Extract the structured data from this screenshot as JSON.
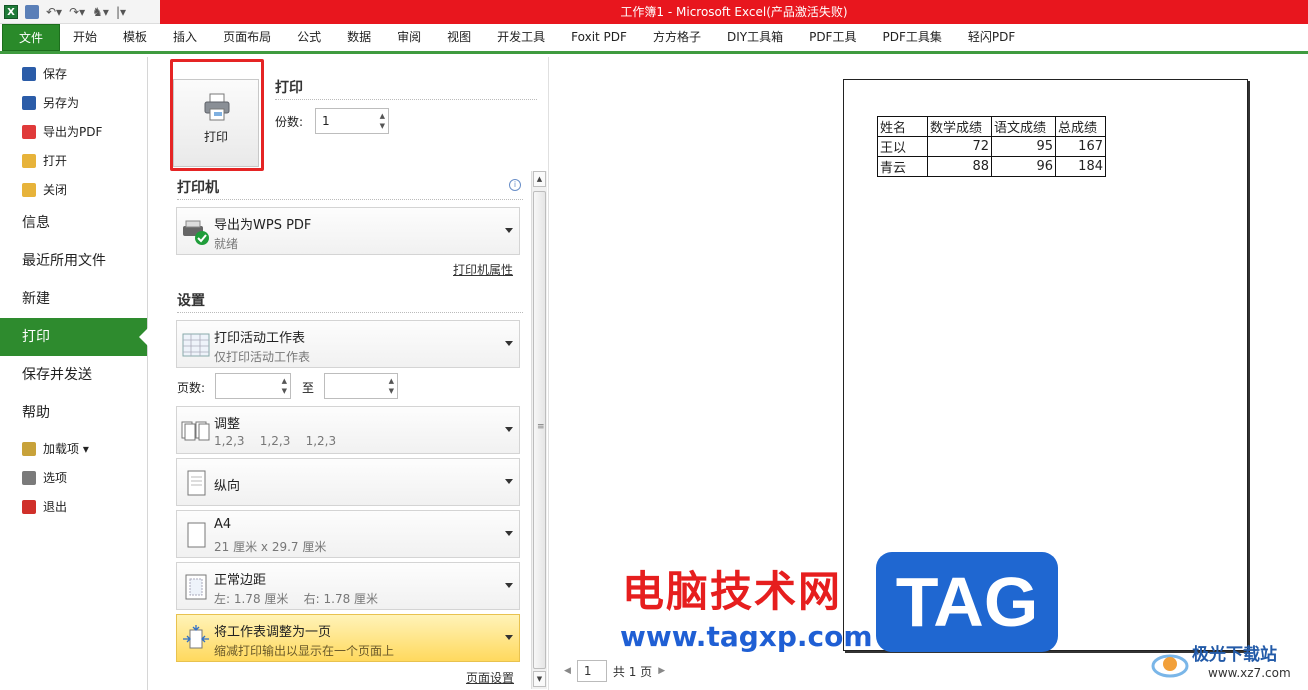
{
  "window": {
    "title": "工作簿1 - Microsoft Excel(产品激活失败)"
  },
  "ribbon": {
    "tabs": [
      "文件",
      "开始",
      "模板",
      "插入",
      "页面布局",
      "公式",
      "数据",
      "审阅",
      "视图",
      "开发工具",
      "Foxit PDF",
      "方方格子",
      "DIY工具箱",
      "PDF工具",
      "PDF工具集",
      "轻闪PDF"
    ]
  },
  "leftnav": {
    "top_items": [
      {
        "label": "保存",
        "icon": "save-icon",
        "color": "#2b5ca8"
      },
      {
        "label": "另存为",
        "icon": "save-as-icon",
        "color": "#2b5ca8"
      },
      {
        "label": "导出为PDF",
        "icon": "pdf-icon",
        "color": "#e03a3a"
      },
      {
        "label": "打开",
        "icon": "folder-open-icon",
        "color": "#e7b33a"
      },
      {
        "label": "关闭",
        "icon": "folder-close-icon",
        "color": "#e7b33a"
      }
    ],
    "big_items": [
      "信息",
      "最近所用文件",
      "新建",
      "打印",
      "保存并发送",
      "帮助"
    ],
    "active": "打印",
    "bottom_items": [
      {
        "label": "加载项 ▾",
        "icon": "addin-icon",
        "color": "#c8a23a"
      },
      {
        "label": "选项",
        "icon": "options-icon",
        "color": "#7a7a7a"
      },
      {
        "label": "退出",
        "icon": "exit-icon",
        "color": "#d0302a"
      }
    ]
  },
  "print": {
    "button_label": "打印",
    "section_title": "打印",
    "copies_label": "份数:",
    "copies_value": "1",
    "printer_section": "打印机",
    "printer_name": "导出为WPS PDF",
    "printer_status": "就绪",
    "printer_properties": "打印机属性",
    "settings_section": "设置",
    "what": {
      "title": "打印活动工作表",
      "sub": "仅打印活动工作表"
    },
    "pages_label": "页数:",
    "pages_to": "至",
    "collate": {
      "title": "调整",
      "sub": "1,2,3    1,2,3    1,2,3"
    },
    "orientation": {
      "title": "纵向"
    },
    "paper": {
      "title": "A4",
      "sub": "21 厘米 x 29.7 厘米"
    },
    "margins": {
      "title": "正常边距",
      "sub": "左: 1.78 厘米    右: 1.78 厘米"
    },
    "scaling": {
      "title": "将工作表调整为一页",
      "sub": "缩减打印输出以显示在一个页面上"
    },
    "page_setup": "页面设置"
  },
  "preview": {
    "table": {
      "headers": [
        "姓名",
        "数学成绩",
        "语文成绩",
        "总成绩"
      ],
      "rows": [
        [
          "王以",
          "72",
          "95",
          "167"
        ],
        [
          "青云",
          "88",
          "96",
          "184"
        ]
      ]
    },
    "page_number": "1",
    "page_total": "共 1 页"
  },
  "watermark": {
    "cn": "电脑技术网",
    "url": "www.tagxp.com",
    "badge": "TAG",
    "logo_name": "极光下载站",
    "logo_site": "www.xz7.com"
  },
  "colors": {
    "accent_green": "#2e8b2e",
    "titlebar_red": "#e8161e",
    "highlight": "#ffd95e"
  }
}
